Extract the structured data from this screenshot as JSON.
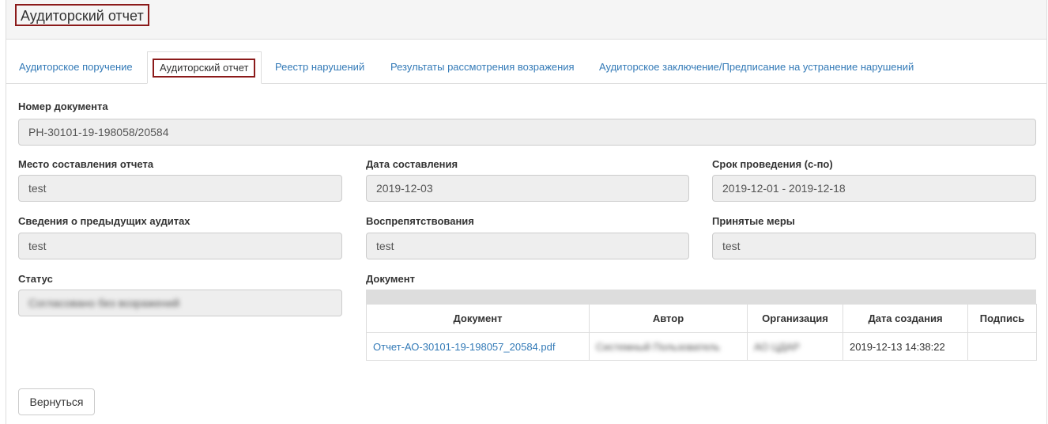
{
  "header": {
    "title": "Аудиторский отчет"
  },
  "tabs": [
    {
      "label": "Аудиторское поручение"
    },
    {
      "label": "Аудиторский отчет"
    },
    {
      "label": "Реестр нарушений"
    },
    {
      "label": "Результаты рассмотрения возражения"
    },
    {
      "label": "Аудиторское заключение/Предписание на устранение нарушений"
    }
  ],
  "form": {
    "doc_number": {
      "label": "Номер документа",
      "value": "РН-30101-19-198058/20584"
    },
    "place": {
      "label": "Место составления отчета",
      "value": "test"
    },
    "date": {
      "label": "Дата составления",
      "value": "2019-12-03"
    },
    "period": {
      "label": "Срок проведения (с-по)",
      "value": "2019-12-01 - 2019-12-18"
    },
    "prev_audits": {
      "label": "Сведения о предыдущих аудитах",
      "value": "test"
    },
    "obstruction": {
      "label": "Воспрепятствования",
      "value": "test"
    },
    "measures": {
      "label": "Принятые меры",
      "value": "test"
    },
    "status": {
      "label": "Статус",
      "value": "Согласовано без возражений"
    }
  },
  "documents": {
    "label": "Документ",
    "columns": [
      "Документ",
      "Автор",
      "Организация",
      "Дата создания",
      "Подпись"
    ],
    "rows": [
      {
        "document": "Отчет-АО-30101-19-198057_20584.pdf",
        "author": "Системный Пользователь",
        "organization": "АО ЦДАР",
        "created": "2019-12-13 14:38:22",
        "signature": ""
      }
    ]
  },
  "actions": {
    "back": "Вернуться"
  }
}
